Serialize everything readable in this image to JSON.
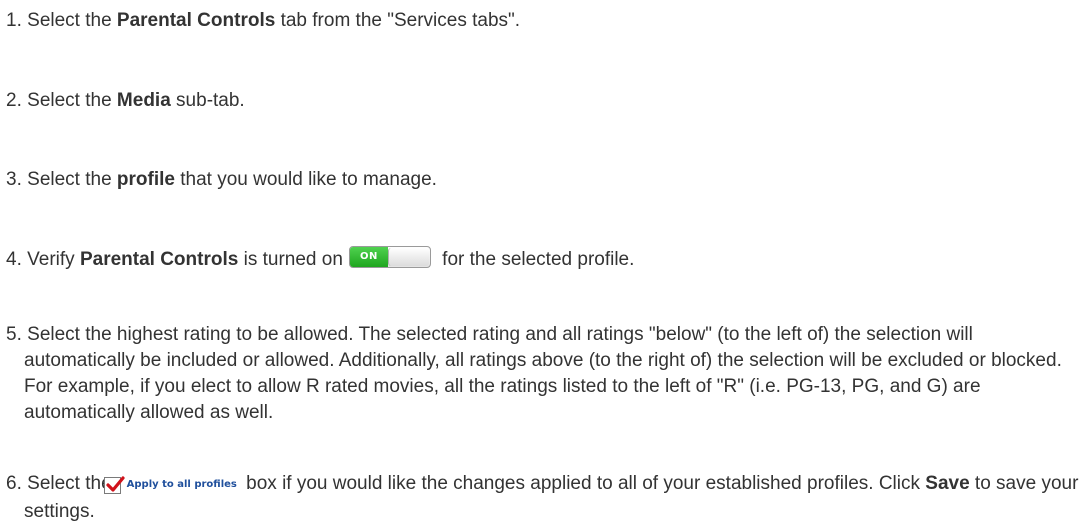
{
  "steps": [
    {
      "num": "1.",
      "pre": "Select the ",
      "bold": "Parental Controls",
      "post": " tab from the \"Services tabs\"."
    },
    {
      "num": "2.",
      "pre": "Select the ",
      "bold": "Media",
      "post": " sub-tab."
    },
    {
      "num": "3.",
      "pre": "Select the ",
      "bold": "profile",
      "post": " that you would like to manage."
    },
    {
      "num": "4.",
      "pre": "Verify ",
      "bold": "Parental Controls",
      "mid": " is turned on",
      "toggle_label": "ON",
      "post": " for the selected profile."
    },
    {
      "num": "5.",
      "text": "Select the highest rating to be allowed. The selected rating and all ratings \"below\" (to the left of) the selection will automatically be included or allowed. Additionally, all ratings above (to the right of) the selection will be excluded or blocked.  For example, if you elect to allow R rated movies, all the ratings listed to the left of \"R\" (i.e. PG-13, PG, and G) are automatically allowed as well."
    },
    {
      "num": "6.",
      "pre": "Select the",
      "checkbox_label": "Apply to all profiles",
      "mid": " box if you would like the changes applied to all of your established profiles. Click ",
      "bold": "Save",
      "post": " to save your settings."
    }
  ],
  "colors": {
    "text": "#333333",
    "toggle_on": "#22b022",
    "checkmark": "#d0121b",
    "apply_label": "#1f4f9c"
  }
}
